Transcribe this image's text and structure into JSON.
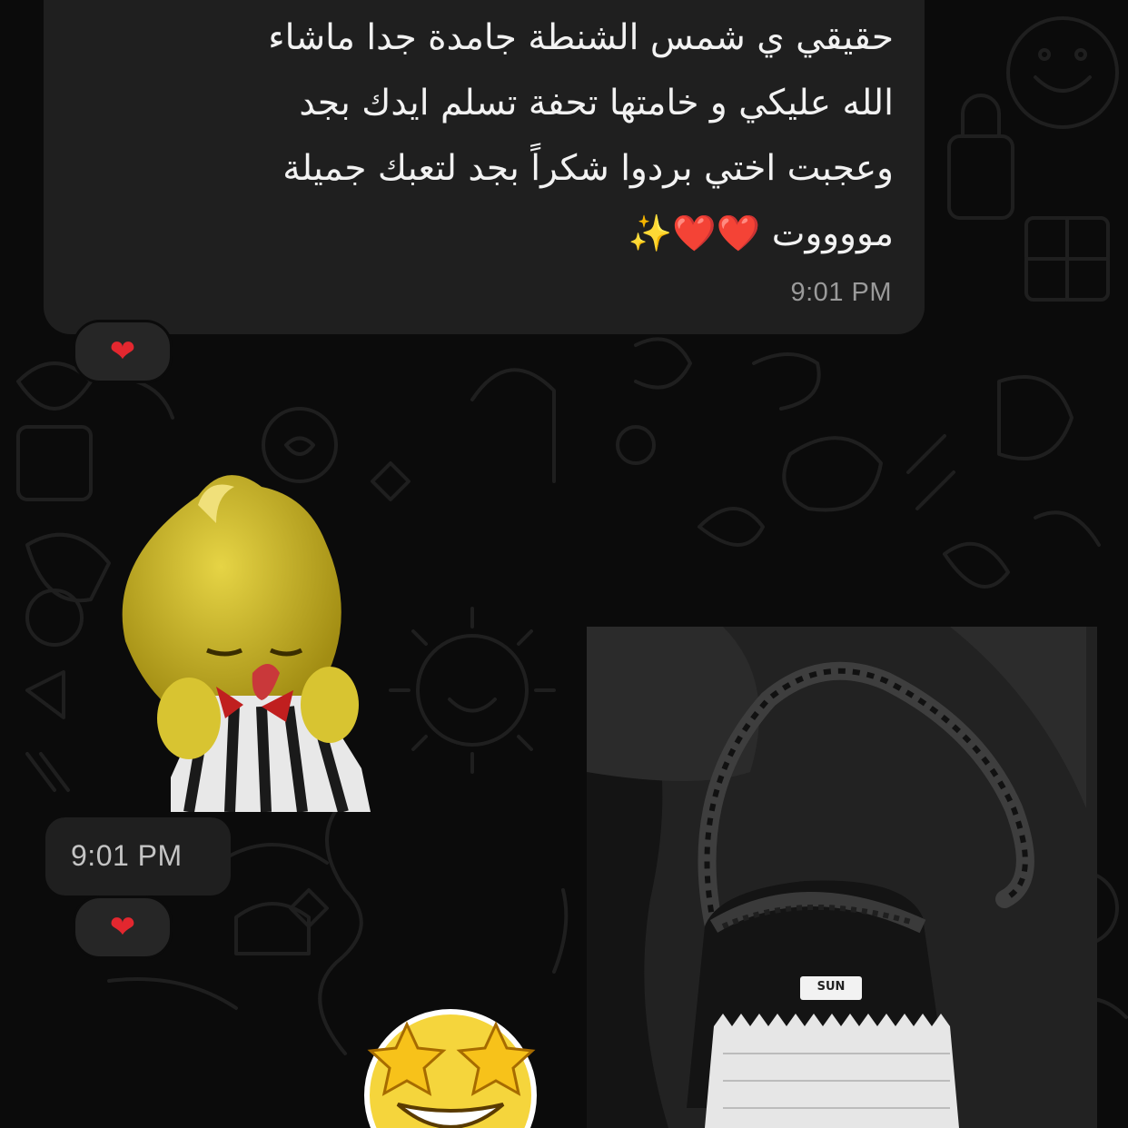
{
  "chat": {
    "incoming_message": {
      "text": "حقيقي ي شمس الشنطة جامدة جدا ماشاء\nالله عليكي و خامتها تحفة تسلم ايدك بجد\nوعجبت اختي بردوا شكراً بجد لتعبك جميلة\nمووووت ❤️❤️✨",
      "time": "9:01 PM",
      "reaction": "❤"
    },
    "sticker_message": {
      "sticker_name": "yellow-chick-mascot",
      "time": "9:01 PM",
      "reaction": "❤"
    },
    "outgoing_photo": {
      "label": "SUN",
      "subject": "crochet-bag"
    },
    "outgoing_sticker": {
      "sticker_name": "star-struck-emoji"
    }
  },
  "colors": {
    "background": "#0b0b0b",
    "bubble": "#1f1f1f",
    "timestamp": "#9a9a9a",
    "heart": "#e3272f"
  }
}
